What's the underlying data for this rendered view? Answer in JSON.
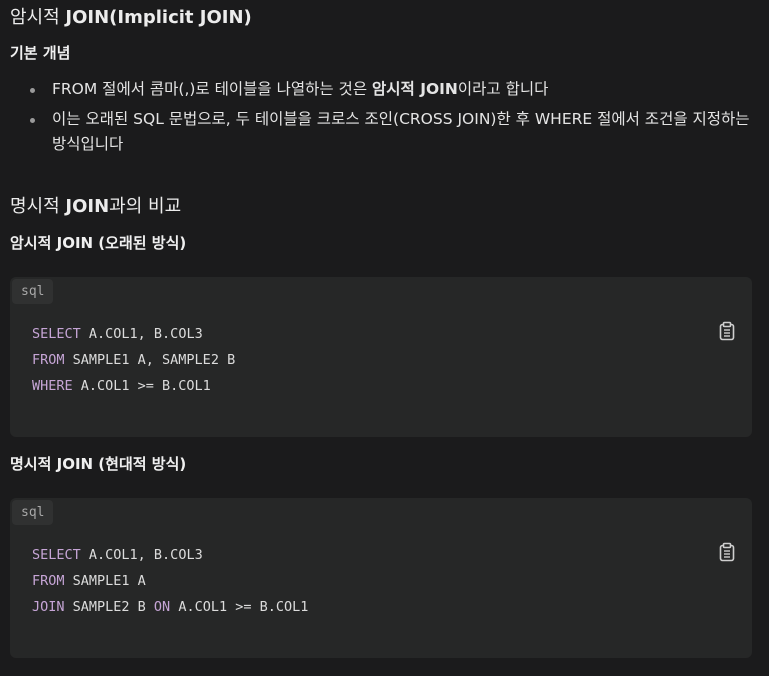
{
  "heading1": {
    "prefix": "암시적 ",
    "bold": "JOIN(Implicit JOIN)"
  },
  "basic_concept_title": "기본 개념",
  "bullets": [
    {
      "parts": [
        "FROM 절에서 콤마(,)로 테이블을 나열하는 것은 ",
        "암시적 JOIN",
        "이라고 합니다"
      ]
    },
    {
      "text": "이는 오래된 SQL 문법으로, 두 테이블을 크로스 조인(CROSS JOIN)한 후 WHERE 절에서 조건을 지정하는 방식입니다"
    }
  ],
  "heading2": {
    "prefix": "명시적 ",
    "bold": "JOIN",
    "suffix": "과의 비교"
  },
  "implicit_title": "암시적 JOIN (오래된 방식)",
  "explicit_title": "명시적 JOIN (현대적 방식)",
  "code_blocks": [
    {
      "lang": "sql",
      "lines": [
        {
          "kw": "SELECT",
          "rest": " A.COL1, B.COL3"
        },
        {
          "kw": "FROM",
          "rest": " SAMPLE1 A, SAMPLE2 B"
        },
        {
          "kw": "WHERE",
          "rest": " A.COL1 >= B.COL1"
        }
      ]
    },
    {
      "lang": "sql",
      "lines": [
        {
          "kw": "SELECT",
          "rest": " A.COL1, B.COL3"
        },
        {
          "kw": "FROM",
          "rest": " SAMPLE1 A"
        },
        {
          "kw": "JOIN",
          "rest": " SAMPLE2 B ",
          "kw2": "ON",
          "rest2": " A.COL1 >= B.COL1"
        }
      ]
    }
  ],
  "colors": {
    "background": "#1b1b1c",
    "code_background": "#262727",
    "keyword": "#c6a5d6",
    "text": "#e8e8e8"
  },
  "icons": {
    "copy": "clipboard-icon"
  }
}
